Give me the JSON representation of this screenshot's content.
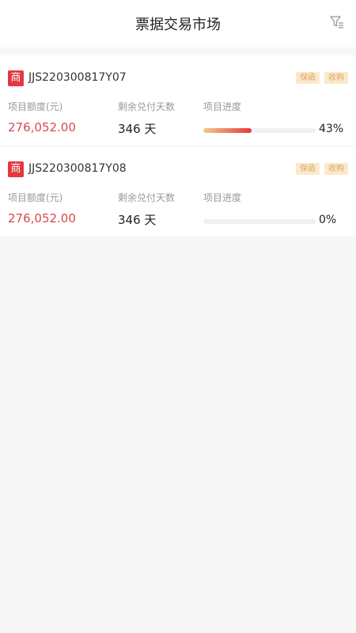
{
  "header": {
    "title": "票据交易市场",
    "filter_icon": "filter-icon"
  },
  "colors": {
    "accent_red": "#e3383f",
    "amount_red": "#d9474b",
    "tag_bg": "#fbe9cd",
    "tag_text": "#dba85a"
  },
  "items": [
    {
      "badge": "商",
      "code": "JJS220300817Y07",
      "tags": [
        "保函",
        "收购"
      ],
      "amount_label": "项目额度(元)",
      "amount": "276,052.00",
      "days_label": "剩余兑付天数",
      "days": "346 天",
      "progress_label": "项目进度",
      "progress": 0.43,
      "progress_text": "43%"
    },
    {
      "badge": "商",
      "code": "JJS220300817Y08",
      "tags": [
        "保函",
        "收购"
      ],
      "amount_label": "项目额度(元)",
      "amount": "276,052.00",
      "days_label": "剩余兑付天数",
      "days": "346 天",
      "progress_label": "项目进度",
      "progress": 0,
      "progress_text": "0%"
    }
  ]
}
